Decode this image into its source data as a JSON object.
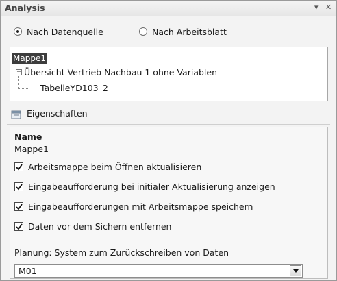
{
  "pane": {
    "title": "Analysis",
    "menu_glyph": "▾",
    "close_glyph": "✕"
  },
  "view_mode": {
    "options": [
      {
        "label": "Nach Datenquelle",
        "checked": true
      },
      {
        "label": "Nach Arbeitsblatt",
        "checked": false
      }
    ]
  },
  "tree": {
    "root": "Mappe1",
    "expander_glyph": "−",
    "child": "Übersicht Vertrieb Nachbau 1 ohne Variablen",
    "leaf": "TabelleYD103_2"
  },
  "properties": {
    "header": "Eigenschaften",
    "name_heading": "Name",
    "name_value": "Mappe1",
    "checkboxes": [
      {
        "label": "Arbeitsmappe beim Öffnen aktualisieren",
        "checked": true
      },
      {
        "label": "Eingabeaufforderung bei initialer Aktualisierung anzeigen",
        "checked": true
      },
      {
        "label": "Eingabeaufforderungen mit Arbeitsmappe speichern",
        "checked": true
      },
      {
        "label": "Daten vor dem Sichern entfernen",
        "checked": true
      }
    ],
    "dropdown_label": "Planung: System zum Zurückschreiben von Daten",
    "dropdown_value": "M01"
  }
}
